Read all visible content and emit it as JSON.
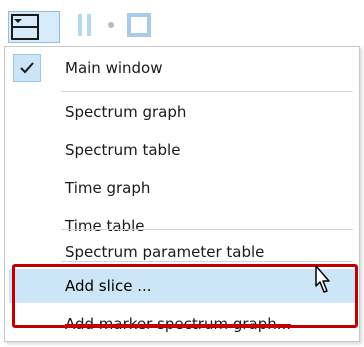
{
  "toolbar": {
    "layout_button_icon": "window-layout-icon",
    "dropdown_icon": "chevron-down-icon",
    "faded_icons": [
      "cursor-bar-icon",
      "dot-icon",
      "fullscreen-icon"
    ]
  },
  "menu": {
    "items": [
      {
        "label": "Main window",
        "checked": true
      },
      {
        "label": "Spectrum graph"
      },
      {
        "label": "Spectrum table"
      },
      {
        "label": "Time graph"
      },
      {
        "label": "Time table"
      },
      {
        "label": "Spectrum parameter table"
      },
      {
        "label": "Add slice ..."
      },
      {
        "label": "Add marker spectrum graph..."
      }
    ]
  },
  "colors": {
    "accent": "#cde6f7",
    "highlight_border": "#c00000",
    "check_bg": "#cce4f7"
  }
}
